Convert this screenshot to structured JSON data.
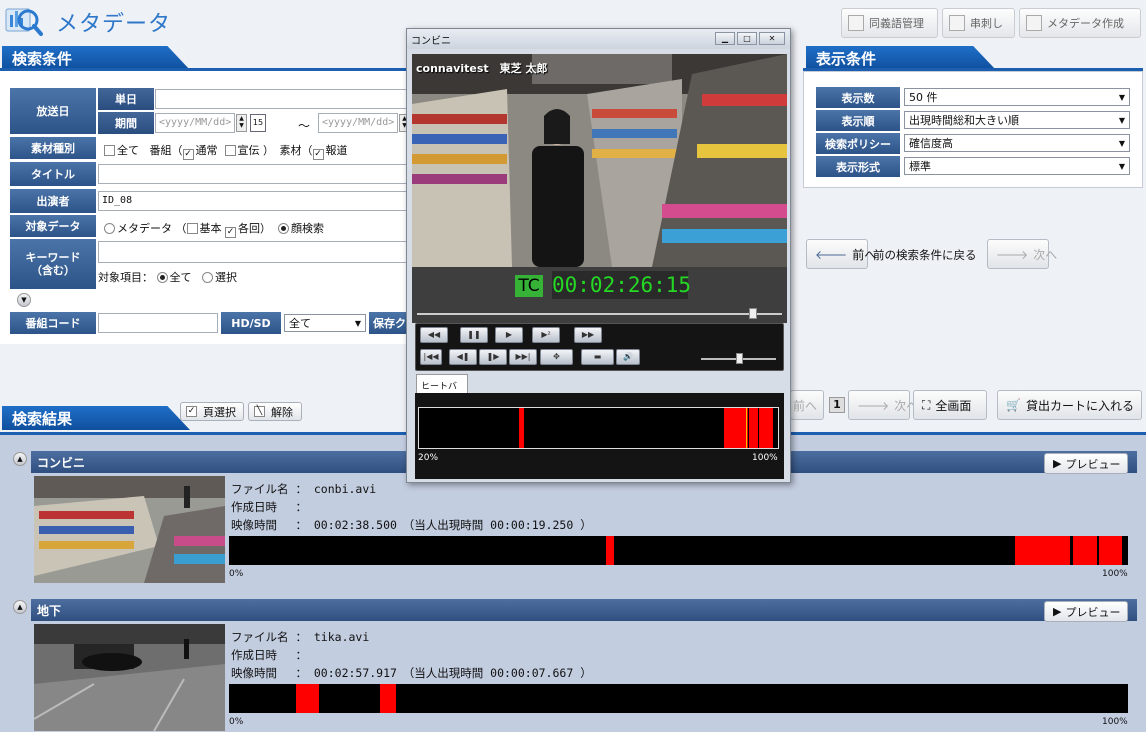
{
  "header": {
    "title": "メタデータ",
    "buttons": [
      "同義語管理",
      "串刺し",
      "メタデータ作成"
    ]
  },
  "search": {
    "section_title": "検索条件",
    "broadcast_date_label": "放送日",
    "single_day_label": "単日",
    "period_label": "期間",
    "date_placeholder": "<yyyy/MM/dd>",
    "range_sep": "～",
    "material_type_label": "素材種別",
    "material_all": "全て",
    "program_prefix": "番組（",
    "program_normal": "通常",
    "program_ad": "宣伝",
    "material_prefix": "）　素材（",
    "material_report": "報道",
    "title_label": "タイトル",
    "performer_label": "出演者",
    "performer_value": "ID_08",
    "target_data_label": "対象データ",
    "target_metadata": "メタデータ",
    "paren_open": "（",
    "target_basic": "基本",
    "target_each": "各回",
    "paren_close": "）",
    "target_face": "顔検索",
    "keyword_label": "キーワード\n（含む）",
    "target_items_label": "対象項目：",
    "target_items_all": "全て",
    "target_items_select": "選択",
    "program_code_label": "番組コード",
    "hdsd_label": "HD/SD",
    "hdsd_value": "全て",
    "save_label": "保存ク"
  },
  "display": {
    "section_title": "表示条件",
    "rows": [
      {
        "label": "表示数",
        "value": "50 件"
      },
      {
        "label": "表示順",
        "value": "出現時間総和大きい順"
      },
      {
        "label": "検索ポリシー",
        "value": "確信度高"
      },
      {
        "label": "表示形式",
        "value": "標準"
      }
    ],
    "prev_label": "前へ",
    "back_text": "前の検索条件に戻る",
    "next_label": "次へ"
  },
  "results": {
    "section_title": "検索結果",
    "page_select": "頁選択",
    "release": "解除",
    "pager_prev": "前へ",
    "pager_page": "1",
    "pager_next": "次へ",
    "fullscreen": "全画面",
    "cart": "貸出カートに入れる",
    "preview": "プレビュー",
    "file_label": "ファイル名",
    "created_label": "作成日時",
    "duration_label": "映像時間",
    "colon": "：",
    "appear_prefix": "（当人出現時間",
    "appear_suffix": "）",
    "pct_start": "0%",
    "pct_end": "100%",
    "items": [
      {
        "title": "コンビニ",
        "file": "conbi.avi",
        "created": "",
        "duration": "00:02:38.500",
        "appear": "00:00:19.250",
        "heat": [
          [
            0.419,
            0.428
          ],
          [
            0.874,
            0.936
          ],
          [
            0.939,
            0.965
          ],
          [
            0.968,
            0.993
          ]
        ]
      },
      {
        "title": "地下",
        "file": "tika.avi",
        "created": "",
        "duration": "00:02:57.917",
        "appear": "00:00:07.667",
        "heat": [
          [
            0.075,
            0.1
          ],
          [
            0.168,
            0.186
          ]
        ]
      }
    ]
  },
  "player": {
    "window_title": "コンビニ",
    "overlay": "connavitest　東芝 太郎",
    "tc_label": "TC",
    "timecode": "00:02:26:15",
    "seek_position": 0.92,
    "volume": 0.5,
    "heat_tab": "ヒートバー",
    "heat_start": "20%",
    "heat_end": "100%",
    "heat": [
      [
        0.278,
        0.292
      ],
      [
        0.85,
        0.916
      ],
      [
        0.919,
        0.944
      ],
      [
        0.947,
        0.986
      ]
    ],
    "marker": 0.912
  },
  "colors": {
    "accent": "#1c5fb0",
    "heat": "#ff0000",
    "timecode": "#24d824"
  }
}
